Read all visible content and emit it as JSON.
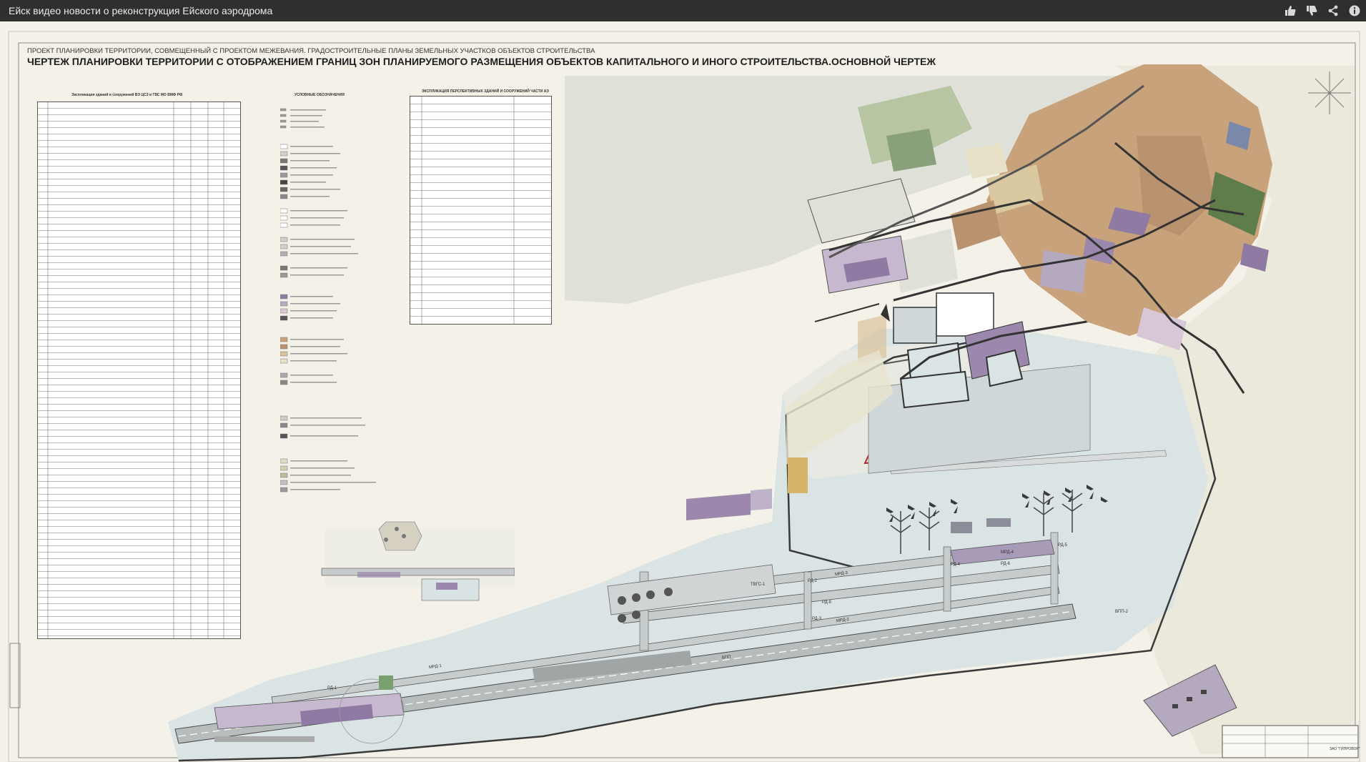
{
  "window": {
    "title": "Ейск видео новости о реконструкция Ейского аэродрома"
  },
  "toolbar": {
    "buttons": [
      {
        "name": "like-button",
        "icon": "thumbs-up-icon"
      },
      {
        "name": "dislike-button",
        "icon": "thumbs-down-icon"
      },
      {
        "name": "share-button",
        "icon": "share-icon"
      },
      {
        "name": "info-button",
        "icon": "info-icon"
      }
    ]
  },
  "drawing": {
    "subtitle": "ПРОЕКТ ПЛАНИРОВКИ ТЕРРИТОРИИ, СОВМЕЩЕННЫЙ С ПРОЕКТОМ МЕЖЕВАНИЯ. ГРАДОСТРОИТЕЛЬНЫЕ ПЛАНЫ ЗЕМЕЛЬНЫХ УЧАСТКОВ ОБЪЕКТОВ  СТРОИТЕЛЬСТВА",
    "title": "ЧЕРТЕЖ ПЛАНИРОВКИ ТЕРРИТОРИИ С ОТОБРАЖЕНИЕМ ГРАНИЦ ЗОН ПЛАНИРУЕМОГО РАЗМЕЩЕНИЯ ОБЪЕКТОВ КАПИТАЛЬНОГО И ИНОГО СТРОИТЕЛЬСТВА.ОСНОВНОЙ ЧЕРТЕЖ",
    "table1_title": "Экспликация зданий и сооружений ВЭ ЦСЗ и ГВС МО ВМФ РФ",
    "legend_title": "УСЛОВНЫЕ ОБОЗНАЧЕНИЯ",
    "table2_title": "ЭКСПЛИКАЦИЯ ПЕРСПЕКТИВНЫХ ЗДАНИЙ И СООРУЖЕНИЙ ЧАСТИ АЭ",
    "labels": {
      "lbl_mrd1": "МРД-1",
      "lbl_rd2": "РД-2",
      "lbl_rd3": "РД-3",
      "lbl_rd4": "РД-4",
      "lbl_rd5": "РД-5",
      "lbl_rd6": "РД-6",
      "lbl_rd8": "РД-8",
      "lbl_mrd2": "МРД-2",
      "lbl_mrd3": "МРД-3",
      "lbl_mrd4": "МРД-4",
      "lbl_vpp": "ВПП",
      "lbl_rd1": "РД-1",
      "lbl_tsgs": "ТВГС-1",
      "lbl_vpp2": "ВПП-2",
      "lbl_company": "ЗАО \"ГИПРОВОР\""
    }
  },
  "colors": {
    "topbar": "#2f2f2f",
    "paper": "#f3f1e8",
    "sea": "#dde0d8",
    "land_blue": "#d9e3e3",
    "tan": "#c8a27a",
    "purple": "#8f7aa3",
    "green": "#5e7d4a",
    "road": "#3a3a3a",
    "red_line": "#b52a2a"
  }
}
